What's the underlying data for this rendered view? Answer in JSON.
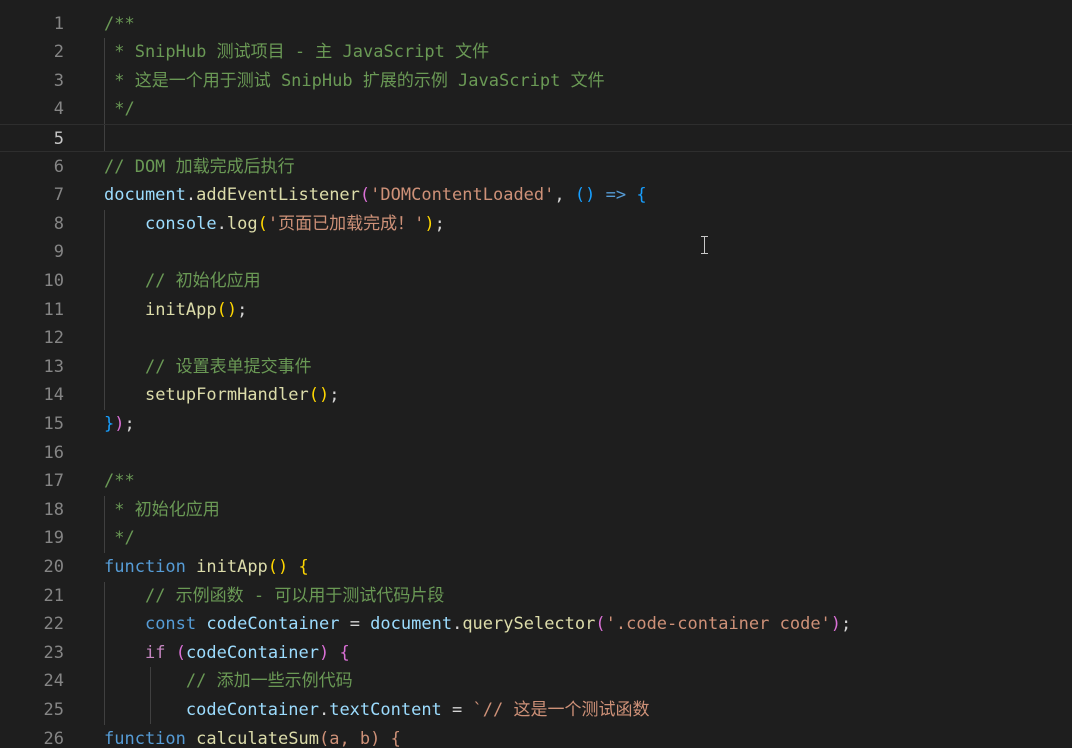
{
  "editor": {
    "language": "JavaScript",
    "active_line": 5,
    "lines": [
      {
        "n": 1,
        "tokens": [
          {
            "t": "/**",
            "c": "cmt"
          }
        ]
      },
      {
        "n": 2,
        "tokens": [
          {
            "t": " * SnipHub 测试项目 - 主 JavaScript 文件",
            "c": "cmt"
          }
        ]
      },
      {
        "n": 3,
        "tokens": [
          {
            "t": " * 这是一个用于测试 SnipHub 扩展的示例 JavaScript 文件",
            "c": "cmt"
          }
        ]
      },
      {
        "n": 4,
        "tokens": [
          {
            "t": " */",
            "c": "cmt"
          }
        ]
      },
      {
        "n": 5,
        "tokens": []
      },
      {
        "n": 6,
        "tokens": [
          {
            "t": "// DOM 加载完成后执行",
            "c": "cmt"
          }
        ]
      },
      {
        "n": 7,
        "tokens": [
          {
            "t": "document",
            "c": "var"
          },
          {
            "t": ".",
            "c": ""
          },
          {
            "t": "addEventListener",
            "c": "fn"
          },
          {
            "t": "(",
            "c": "p2"
          },
          {
            "t": "'DOMContentLoaded'",
            "c": "str"
          },
          {
            "t": ", ",
            "c": ""
          },
          {
            "t": "()",
            "c": "p3"
          },
          {
            "t": " ",
            "c": ""
          },
          {
            "t": "=>",
            "c": "kw"
          },
          {
            "t": " ",
            "c": ""
          },
          {
            "t": "{",
            "c": "p3"
          }
        ]
      },
      {
        "n": 8,
        "tokens": [
          {
            "t": "    ",
            "c": ""
          },
          {
            "t": "console",
            "c": "var"
          },
          {
            "t": ".",
            "c": ""
          },
          {
            "t": "log",
            "c": "fn"
          },
          {
            "t": "(",
            "c": "p1"
          },
          {
            "t": "'页面已加载完成！'",
            "c": "str"
          },
          {
            "t": ")",
            "c": "p1"
          },
          {
            "t": ";",
            "c": ""
          }
        ]
      },
      {
        "n": 9,
        "tokens": []
      },
      {
        "n": 10,
        "tokens": [
          {
            "t": "    ",
            "c": ""
          },
          {
            "t": "// 初始化应用",
            "c": "cmt"
          }
        ]
      },
      {
        "n": 11,
        "tokens": [
          {
            "t": "    ",
            "c": ""
          },
          {
            "t": "initApp",
            "c": "fn"
          },
          {
            "t": "()",
            "c": "p1"
          },
          {
            "t": ";",
            "c": ""
          }
        ]
      },
      {
        "n": 12,
        "tokens": []
      },
      {
        "n": 13,
        "tokens": [
          {
            "t": "    ",
            "c": ""
          },
          {
            "t": "// 设置表单提交事件",
            "c": "cmt"
          }
        ]
      },
      {
        "n": 14,
        "tokens": [
          {
            "t": "    ",
            "c": ""
          },
          {
            "t": "setupFormHandler",
            "c": "fn"
          },
          {
            "t": "()",
            "c": "p1"
          },
          {
            "t": ";",
            "c": ""
          }
        ]
      },
      {
        "n": 15,
        "tokens": [
          {
            "t": "}",
            "c": "p3"
          },
          {
            "t": ")",
            "c": "p2"
          },
          {
            "t": ";",
            "c": ""
          }
        ]
      },
      {
        "n": 16,
        "tokens": []
      },
      {
        "n": 17,
        "tokens": [
          {
            "t": "/**",
            "c": "cmt"
          }
        ]
      },
      {
        "n": 18,
        "tokens": [
          {
            "t": " * 初始化应用",
            "c": "cmt"
          }
        ]
      },
      {
        "n": 19,
        "tokens": [
          {
            "t": " */",
            "c": "cmt"
          }
        ]
      },
      {
        "n": 20,
        "tokens": [
          {
            "t": "function",
            "c": "kw"
          },
          {
            "t": " ",
            "c": ""
          },
          {
            "t": "initApp",
            "c": "fn"
          },
          {
            "t": "()",
            "c": "p1"
          },
          {
            "t": " ",
            "c": ""
          },
          {
            "t": "{",
            "c": "p1"
          }
        ]
      },
      {
        "n": 21,
        "tokens": [
          {
            "t": "    ",
            "c": ""
          },
          {
            "t": "// 示例函数 - 可以用于测试代码片段",
            "c": "cmt"
          }
        ]
      },
      {
        "n": 22,
        "tokens": [
          {
            "t": "    ",
            "c": ""
          },
          {
            "t": "const",
            "c": "kw"
          },
          {
            "t": " ",
            "c": ""
          },
          {
            "t": "codeContainer",
            "c": "var"
          },
          {
            "t": " = ",
            "c": ""
          },
          {
            "t": "document",
            "c": "var"
          },
          {
            "t": ".",
            "c": ""
          },
          {
            "t": "querySelector",
            "c": "fn"
          },
          {
            "t": "(",
            "c": "p2"
          },
          {
            "t": "'.code-container code'",
            "c": "str"
          },
          {
            "t": ")",
            "c": "p2"
          },
          {
            "t": ";",
            "c": ""
          }
        ]
      },
      {
        "n": 23,
        "tokens": [
          {
            "t": "    ",
            "c": ""
          },
          {
            "t": "if",
            "c": "ctl"
          },
          {
            "t": " ",
            "c": ""
          },
          {
            "t": "(",
            "c": "p2"
          },
          {
            "t": "codeContainer",
            "c": "var"
          },
          {
            "t": ")",
            "c": "p2"
          },
          {
            "t": " ",
            "c": ""
          },
          {
            "t": "{",
            "c": "p2"
          }
        ]
      },
      {
        "n": 24,
        "tokens": [
          {
            "t": "        ",
            "c": ""
          },
          {
            "t": "// 添加一些示例代码",
            "c": "cmt"
          }
        ]
      },
      {
        "n": 25,
        "tokens": [
          {
            "t": "        ",
            "c": ""
          },
          {
            "t": "codeContainer",
            "c": "var"
          },
          {
            "t": ".",
            "c": ""
          },
          {
            "t": "textContent",
            "c": "var"
          },
          {
            "t": " = ",
            "c": ""
          },
          {
            "t": "`// 这是一个测试函数",
            "c": "str"
          }
        ]
      },
      {
        "n": 26,
        "tokens": [
          {
            "t": "function",
            "c": "kw"
          },
          {
            "t": " ",
            "c": ""
          },
          {
            "t": "calculateSum",
            "c": "fn"
          },
          {
            "t": "(a, b) {",
            "c": "str"
          }
        ]
      }
    ]
  }
}
